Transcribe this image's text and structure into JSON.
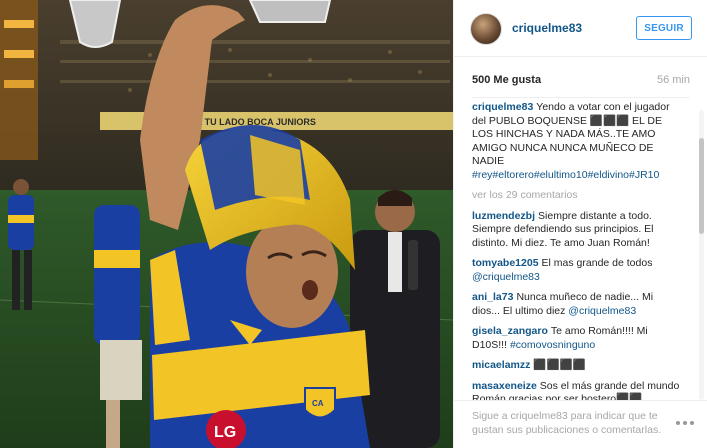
{
  "header": {
    "username": "criquelme83",
    "follow_label": "SEGUIR"
  },
  "stats": {
    "likes": "500 Me gusta",
    "time": "56 min"
  },
  "caption": {
    "user": "criquelme83",
    "text": "Yendo a votar con el jugador del PUBLO BOQUENSE ⬛⬛⬛ EL DE LOS HINCHAS Y NADA MÁS..TE AMO AMIGO NUNCA NUNCA MUÑECO DE NADIE",
    "hashtags": "#rey#eltorero#elultimo10#eldivino#JR10"
  },
  "view_more": "ver los 29 comentarios",
  "comments": [
    {
      "user": "luzmendezbj",
      "text": "Siempre distante a todo. Siempre defendiendo sus principios. El distinto. Mi diez. Te amo Juan Román!",
      "tag": ""
    },
    {
      "user": "tomyabe1205",
      "text": "El mas grande de todos",
      "tag": "@criquelme83"
    },
    {
      "user": "ani_la73",
      "text": "Nunca muñeco de nadie... Mi dios... El ultimo diez",
      "tag": "@criquelme83"
    },
    {
      "user": "gisela_zangaro",
      "text": "Te amo Román!!!! Mi D10S!!!",
      "tag": "#comovosninguno"
    },
    {
      "user": "micaelamzz",
      "text": "⬛⬛⬛⬛",
      "tag": ""
    },
    {
      "user": "masaxeneize",
      "text": "Sos el más grande del mundo Román gracias por ser bostero⬛⬛",
      "tag": ""
    }
  ],
  "footer": {
    "text": "Sigue a criquelme83 para indicar que te gustan sus publicaciones o comentarlas."
  },
  "banner": {
    "text": "COPA SERA TU LADO BOCA JUNIORS"
  },
  "sponsor": {
    "text": "LG"
  },
  "colors": {
    "link": "#125688",
    "follow": "#3897f0",
    "muted": "#a5a7aa",
    "boca_blue": "#1a3fa3",
    "boca_gold": "#f3c425"
  }
}
